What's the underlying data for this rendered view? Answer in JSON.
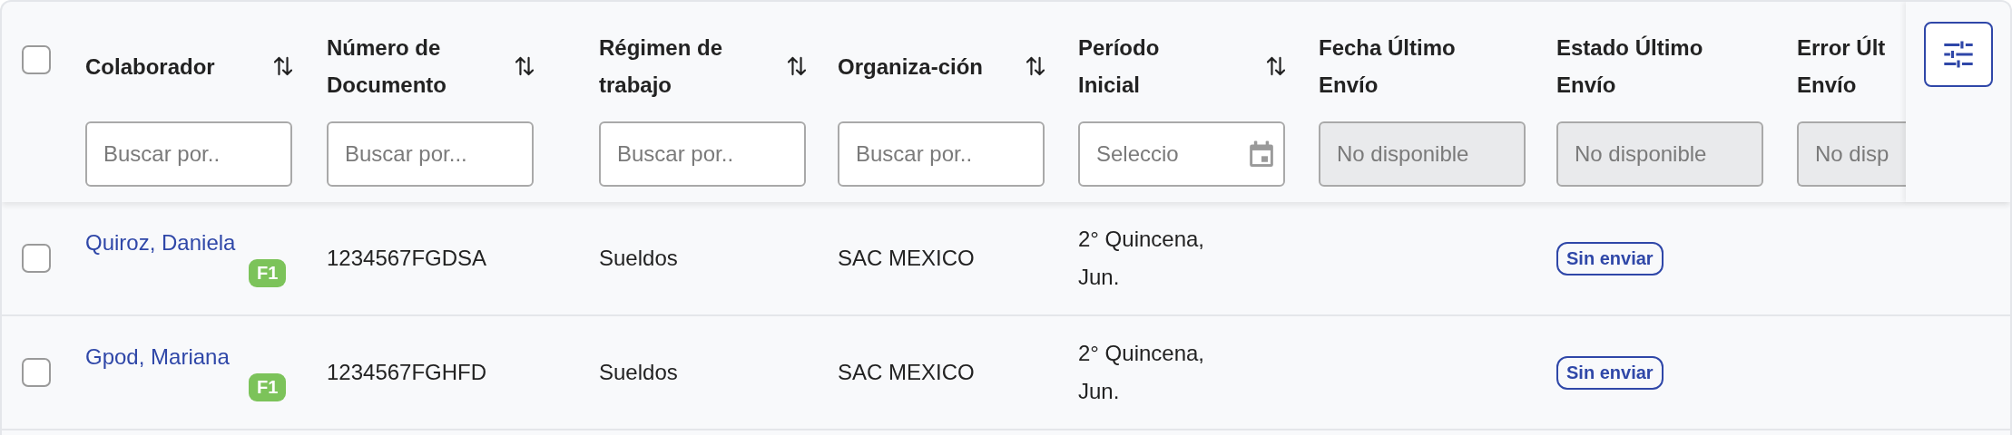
{
  "select_all": {
    "checked": false
  },
  "columns": [
    {
      "label": "Colaborador",
      "sortable": true,
      "filter": {
        "kind": "text",
        "placeholder": "Buscar por.."
      }
    },
    {
      "label": "Número de Documento",
      "sortable": true,
      "filter": {
        "kind": "text",
        "placeholder": "Buscar por..."
      }
    },
    {
      "label": "Régimen de trabajo",
      "sortable": true,
      "filter": {
        "kind": "text",
        "placeholder": "Buscar por.."
      }
    },
    {
      "label": "Organiza-ción",
      "sortable": true,
      "filter": {
        "kind": "text",
        "placeholder": "Buscar por.."
      }
    },
    {
      "label": "Período Inicial",
      "sortable": true,
      "filter": {
        "kind": "date",
        "placeholder": "Seleccio"
      }
    },
    {
      "label": "Fecha Último Envío",
      "sortable": false,
      "filter": {
        "kind": "disabled",
        "placeholder": "No disponible"
      }
    },
    {
      "label": "Estado Último Envío",
      "sortable": false,
      "filter": {
        "kind": "disabled",
        "placeholder": "No disponible"
      }
    },
    {
      "label": "Error Últ Envío",
      "sortable": false,
      "filter": {
        "kind": "disabled",
        "placeholder": "No disp"
      }
    }
  ],
  "rows": [
    {
      "checked": false,
      "name": "Quiroz, Daniela",
      "badge": "F1",
      "document": "1234567FGDSA",
      "regime": "Sueldos",
      "organization": "SAC MEXICO",
      "period": "2° Quincena, Jun.",
      "status": "Sin enviar"
    },
    {
      "checked": false,
      "name": "Gpod, Mariana",
      "badge": "F1",
      "document": "1234567FGHFD",
      "regime": "Sueldos",
      "organization": "SAC MEXICO",
      "period": "2° Quincena, Jun.",
      "status": "Sin enviar"
    }
  ]
}
